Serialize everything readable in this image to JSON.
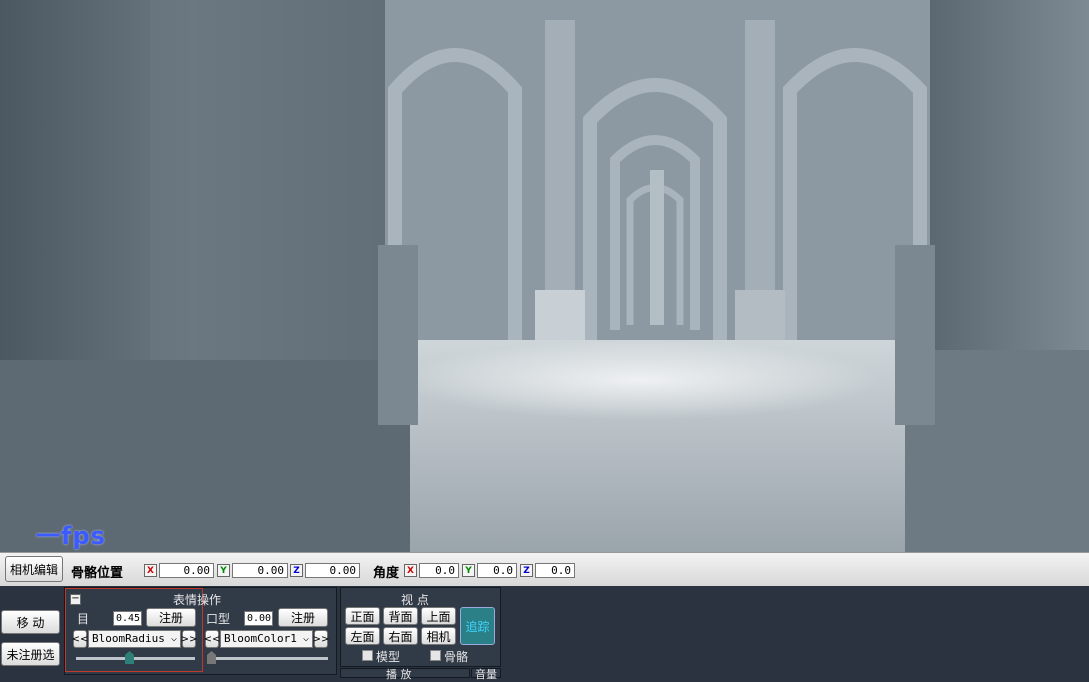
{
  "viewport": {
    "fps_label": "一fps"
  },
  "bone_bar": {
    "camera_edit_button": "相机编辑",
    "bone_position_label": "骨骼位置",
    "pos_x": "0.00",
    "pos_y": "0.00",
    "pos_z": "0.00",
    "angle_label": "角度",
    "ang_x": "0.0",
    "ang_y": "0.0",
    "ang_z": "0.0",
    "axis_x": "X",
    "axis_y": "Y",
    "axis_z": "Z",
    "colors": {
      "x": "#cc0000",
      "y": "#008800",
      "z": "#0000cc"
    }
  },
  "left_buttons": {
    "move": "移 动",
    "unregistered_select": "未注册选"
  },
  "expression_panel": {
    "title": "表情操作",
    "collapse_symbol": "−",
    "eye": {
      "label": "目",
      "value": "0.45(",
      "register_button": "注册",
      "dropdown": "BloomRadius",
      "slider_value": 0.45
    },
    "mouth": {
      "label": "口型",
      "value": "0.00(",
      "register_button": "注册",
      "dropdown": "BloomColor1",
      "slider_value": 0.0
    },
    "prev_symbol": "<<",
    "next_symbol": ">>",
    "highlight_color": "#c0392b"
  },
  "view_panel": {
    "title": "视 点",
    "front": "正面",
    "back": "背面",
    "top": "上面",
    "left": "左面",
    "right": "右面",
    "camera": "相机",
    "track": "追踪",
    "model_label": "模型",
    "bone_label": "骨骼",
    "track_color": "#2b7f86"
  },
  "bottom_panels": {
    "play_label": "播 放",
    "volume_label": "音量"
  }
}
